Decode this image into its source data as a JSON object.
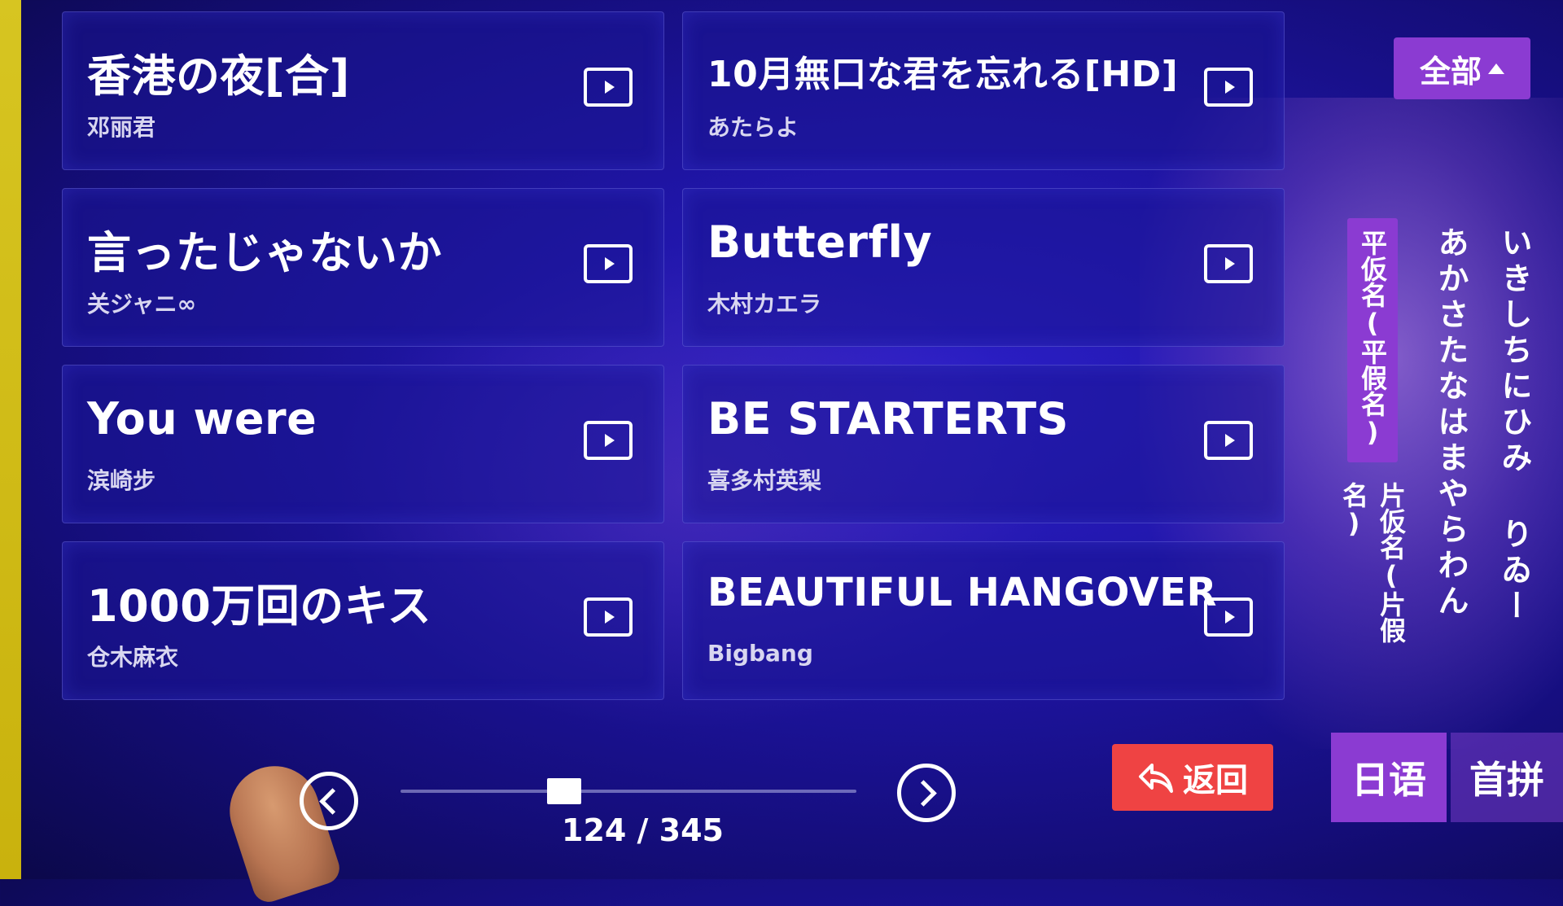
{
  "songs": [
    {
      "title": "香港の夜[合]",
      "artist": "邓丽君"
    },
    {
      "title": "10月無口な君を忘れる[HD]",
      "artist": "あたらよ"
    },
    {
      "title": "言ったじゃないか",
      "artist": "关ジャニ∞"
    },
    {
      "title": "Butterfly",
      "artist": "木村カエラ"
    },
    {
      "title": "You were",
      "artist": "滨崎步"
    },
    {
      "title": "BE STARTERTS",
      "artist": "喜多村英梨"
    },
    {
      "title": "1000万回のキス",
      "artist": "仓木麻衣"
    },
    {
      "title": "BEAUTIFUL HANGOVER",
      "artist": "Bigbang"
    }
  ],
  "filter": {
    "label": "全部"
  },
  "kana": {
    "hiragana_tab": "平仮名(平假名)",
    "katakana_tab": "片仮名(片假名)",
    "column1": "あかさたなはまやらわん",
    "column2": "いきしちにひみ りゐー"
  },
  "pager": {
    "text": "124 / 345",
    "progress": 0.359
  },
  "back": {
    "label": "返回"
  },
  "lang_tabs": {
    "japanese": "日语",
    "pinyin": "首拼"
  },
  "colors": {
    "accent": "#8b3bd2",
    "back": "#ef4343",
    "background": "#1f15a6"
  }
}
